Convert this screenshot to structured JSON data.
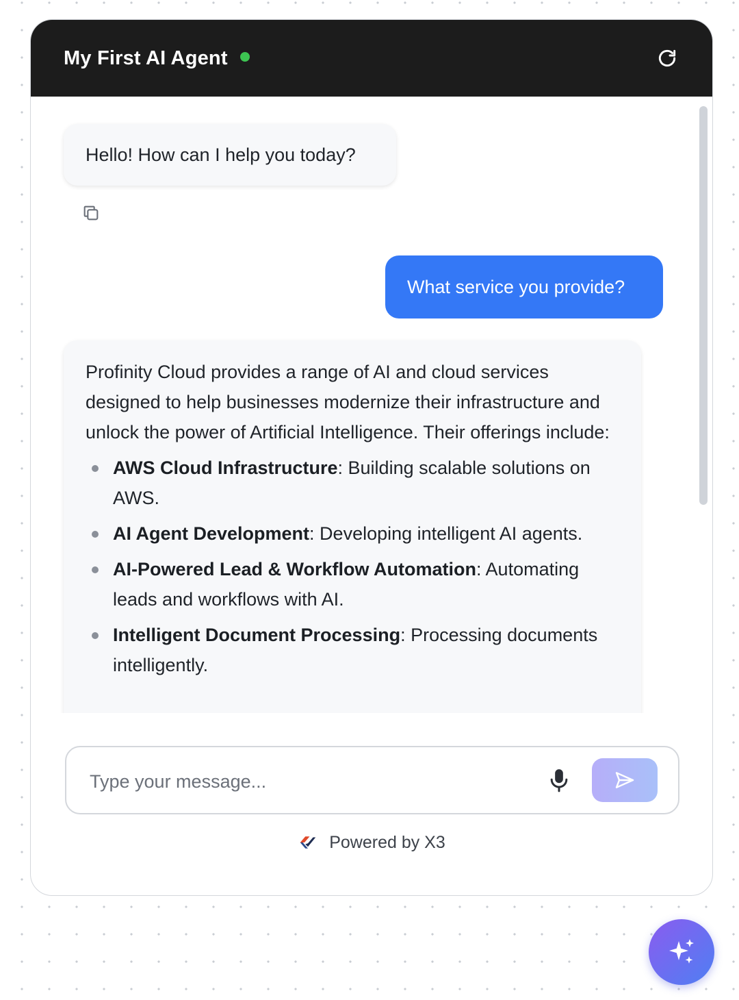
{
  "header": {
    "title": "My First AI Agent",
    "status": "online",
    "status_color": "#3dc452",
    "refresh_icon": "refresh-icon"
  },
  "messages": {
    "greeting": "Hello! How can I help you today?",
    "copy_icon": "copy-icon",
    "user_question": "What service you provide?",
    "answer_intro": "Profinity Cloud provides a range of AI and cloud services designed to help businesses modernize their infrastructure and unlock the power of Artificial Intelligence. Their offerings include:",
    "answer_items": [
      {
        "title": "AWS Cloud Infrastructure",
        "desc": ": Building scalable solutions on AWS."
      },
      {
        "title": "AI Agent Development",
        "desc": ": Developing intelligent AI agents."
      },
      {
        "title": "AI-Powered Lead & Workflow Automation",
        "desc": ": Automating leads and workflows with AI."
      },
      {
        "title": "Intelligent Document Processing",
        "desc": ": Processing documents intelligently."
      }
    ]
  },
  "composer": {
    "placeholder": "Type your message...",
    "value": "",
    "mic_icon": "microphone-icon",
    "send_icon": "send-icon"
  },
  "footer": {
    "powered_by": "Powered by X3",
    "logo_icon": "x3-logo-icon"
  },
  "launcher": {
    "icon": "sparkles-icon"
  },
  "colors": {
    "header_bg": "#1c1c1c",
    "user_bubble": "#3478f6",
    "bot_bubble": "#f7f8fa",
    "launcher_gradient_start": "#8a5cf0",
    "launcher_gradient_end": "#4f7ff2"
  }
}
